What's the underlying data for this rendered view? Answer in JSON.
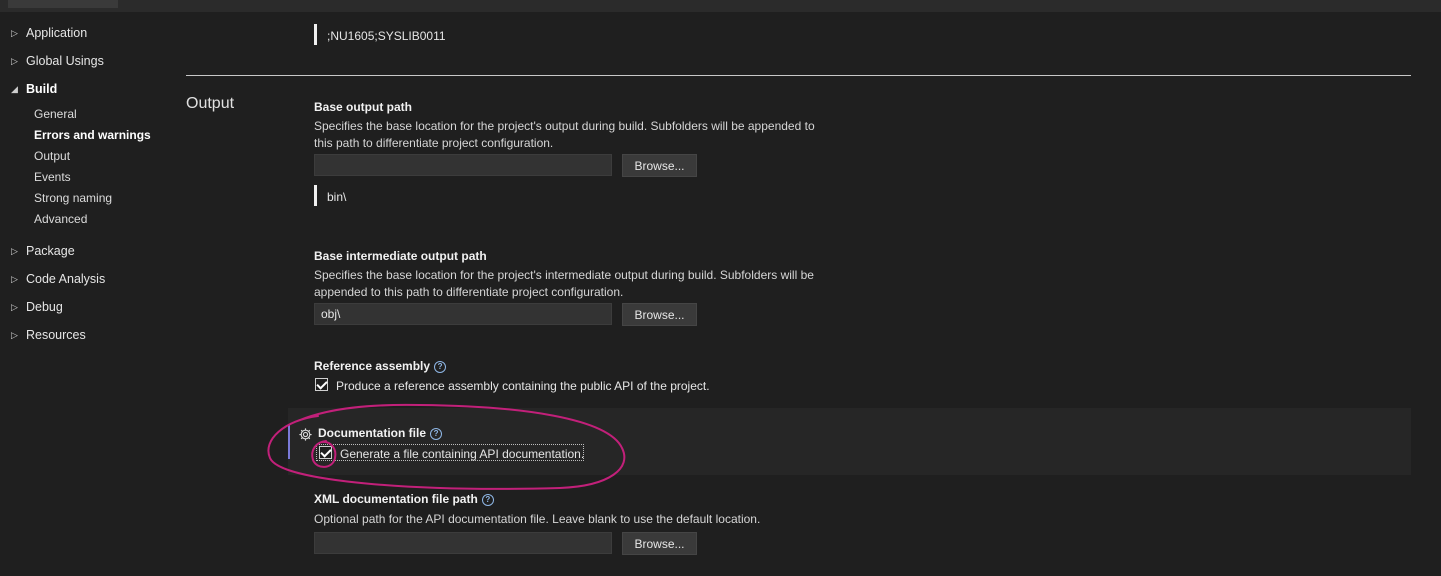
{
  "sidebar": {
    "groups": [
      {
        "label": "Application",
        "expanded": false
      },
      {
        "label": "Global Usings",
        "expanded": false
      },
      {
        "label": "Build",
        "expanded": true
      },
      {
        "label": "Package",
        "expanded": false
      },
      {
        "label": "Code Analysis",
        "expanded": false
      },
      {
        "label": "Debug",
        "expanded": false
      },
      {
        "label": "Resources",
        "expanded": false
      }
    ],
    "build_items": [
      {
        "label": "General"
      },
      {
        "label": "Errors and warnings",
        "active": true
      },
      {
        "label": "Output"
      },
      {
        "label": "Events"
      },
      {
        "label": "Strong naming"
      },
      {
        "label": "Advanced"
      }
    ]
  },
  "top_value": ";NU1605;SYSLIB0011",
  "section": {
    "title": "Output",
    "base_output": {
      "title": "Base output path",
      "desc": "Specifies the base location for the project's output during build. Subfolders will be appended to this path to differentiate project configuration.",
      "value": "",
      "button": "Browse...",
      "effective_value": "bin\\"
    },
    "base_intermediate": {
      "title": "Base intermediate output path",
      "desc": "Specifies the base location for the project's intermediate output during build. Subfolders will be appended to this path to differentiate project configuration.",
      "value": "obj\\",
      "button": "Browse..."
    },
    "reference_assembly": {
      "title": "Reference assembly",
      "checkbox_label": "Produce a reference assembly containing the public API of the project.",
      "checked": true
    },
    "documentation_file": {
      "title": "Documentation file",
      "checkbox_label": "Generate a file containing API documentation.",
      "checked": true
    },
    "xml_doc_path": {
      "title": "XML documentation file path",
      "desc": "Optional path for the API documentation file. Leave blank to use the default location.",
      "value": "",
      "button": "Browse..."
    }
  },
  "icons": {
    "help": "?",
    "collapsed": "▷",
    "expanded": "◢"
  },
  "colors": {
    "background": "#1f1f1f",
    "accent": "#7a7ad8",
    "help": "#8fb7e6",
    "annotation": "#c2207a"
  }
}
